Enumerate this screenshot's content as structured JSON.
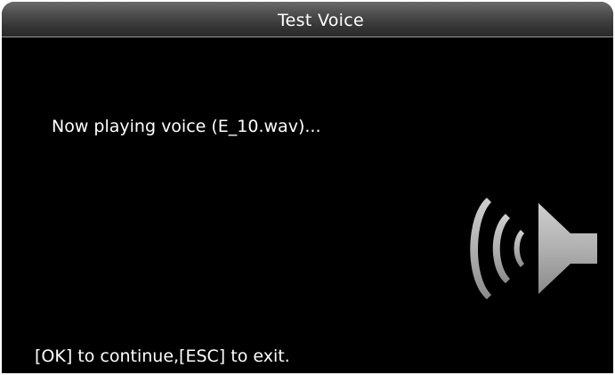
{
  "window": {
    "title": "Test Voice"
  },
  "main": {
    "message": "Now playing voice (E_10.wav)..."
  },
  "footer": {
    "hint": "[OK] to continue,[ESC] to exit."
  },
  "icons": {
    "speaker": "speaker-sound-icon"
  },
  "colors": {
    "background": "#000000",
    "text": "#ffffff",
    "icon": "#b4b4b4"
  }
}
